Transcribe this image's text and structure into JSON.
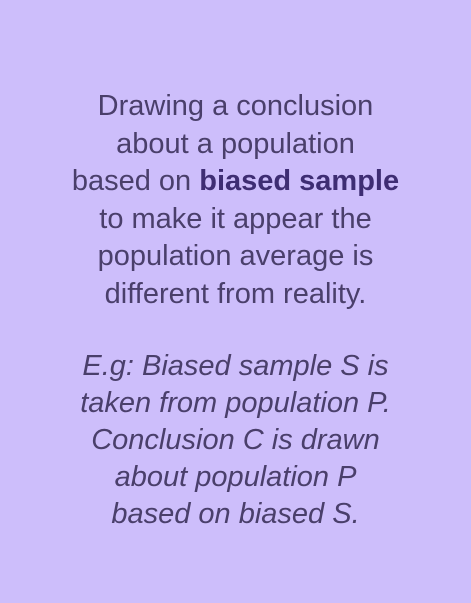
{
  "card": {
    "background": "#cdbefb",
    "text_color": "#4a3f6b",
    "definition": {
      "line1": "Drawing a conclusion",
      "line2": "about a population",
      "line3_prefix": "based on ",
      "line3_bold": "biased sample",
      "line4": "to make it appear the",
      "line5": "population average is",
      "line6": "different from reality."
    },
    "example": {
      "line1": "E.g: Biased sample S is",
      "line2": "taken from population P.",
      "line3": "Conclusion C is drawn",
      "line4": "about population P",
      "line5": "based on biased S."
    }
  }
}
